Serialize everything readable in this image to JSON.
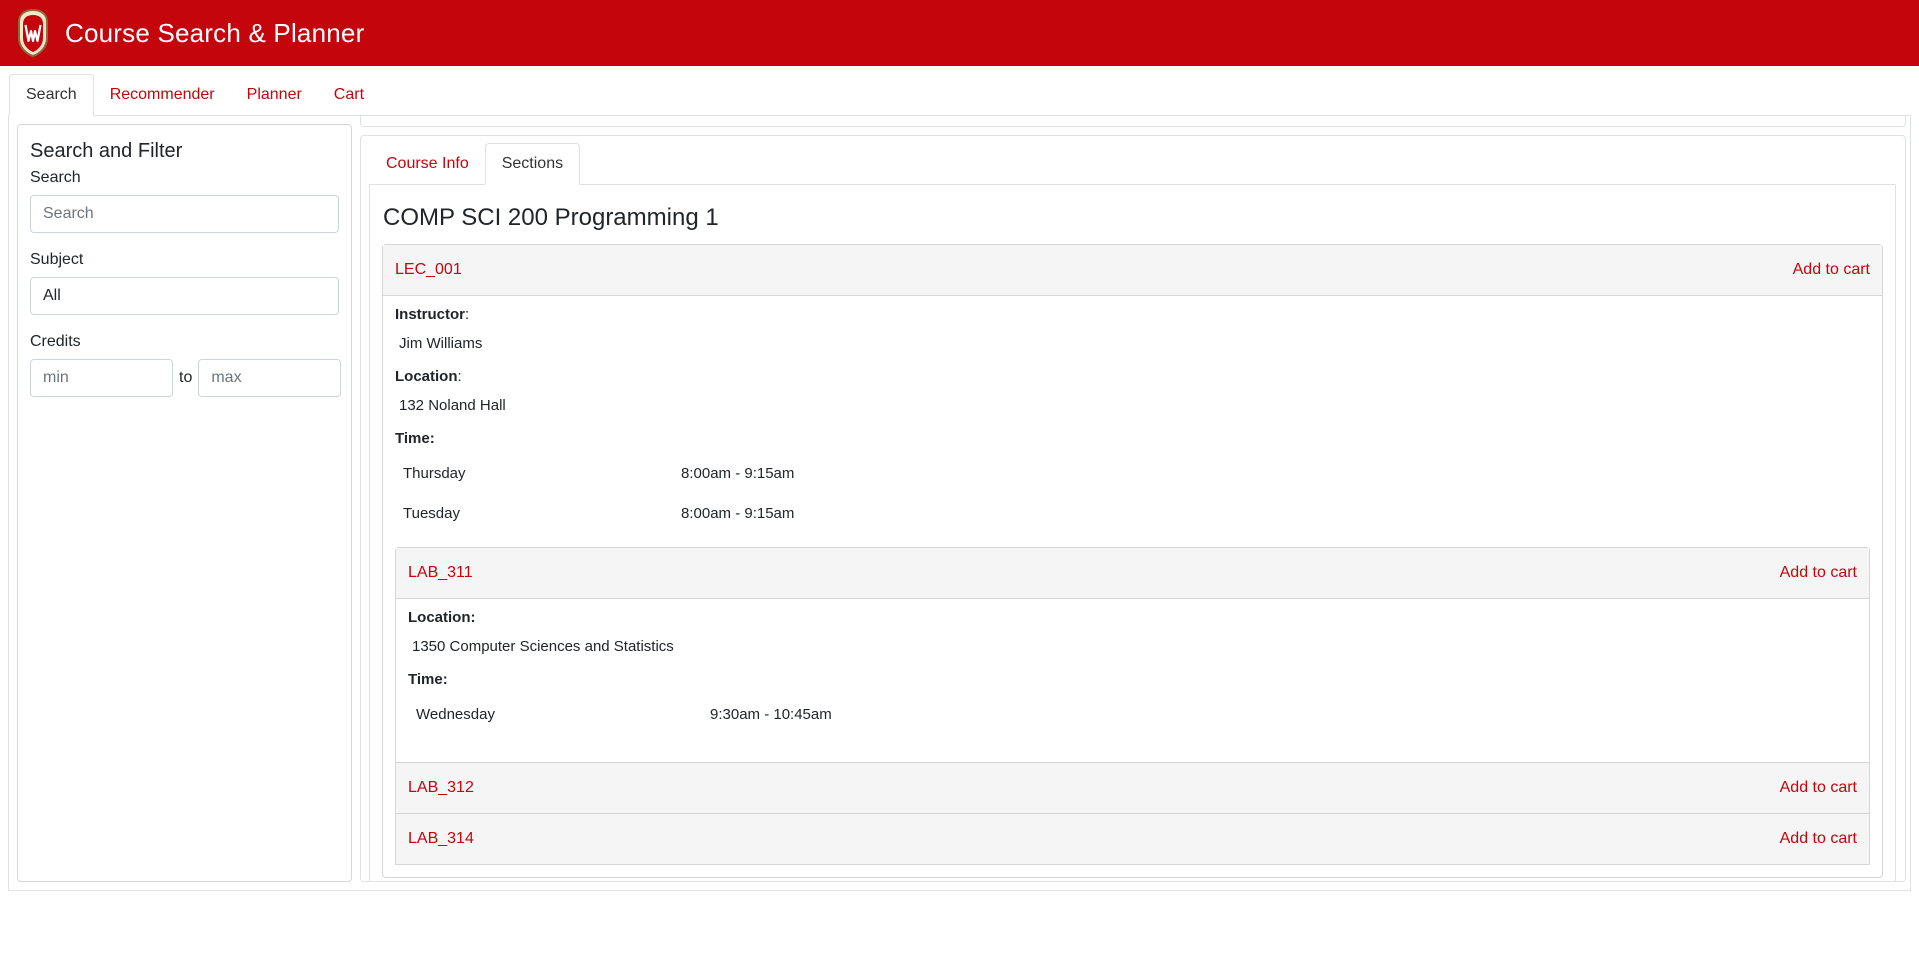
{
  "app": {
    "title": "Course Search & Planner",
    "brand_color": "#c5050c",
    "logo_icon": "uw-crest-icon"
  },
  "main_tabs": [
    {
      "label": "Search",
      "active": true
    },
    {
      "label": "Recommender",
      "active": false
    },
    {
      "label": "Planner",
      "active": false
    },
    {
      "label": "Cart",
      "active": false
    }
  ],
  "sidebar": {
    "title": "Search and Filter",
    "search_label": "Search",
    "search_placeholder": "Search",
    "subject_label": "Subject",
    "subject_value": "All",
    "credits_label": "Credits",
    "credits_min_placeholder": "min",
    "credits_to": "to",
    "credits_max_placeholder": "max"
  },
  "detail_tabs": [
    {
      "label": "Course Info",
      "active": false
    },
    {
      "label": "Sections",
      "active": true
    }
  ],
  "course": {
    "title": "COMP SCI 200 Programming 1",
    "lecture": {
      "name": "LEC_001",
      "add_to_cart": "Add to cart",
      "instructor_label": "Instructor",
      "instructor_colon": ":",
      "instructor": "Jim Williams",
      "location_label": "Location",
      "location_colon": ":",
      "location": "132 Noland Hall",
      "time_label": "Time:",
      "times": [
        {
          "day": "Thursday",
          "time": "8:00am - 9:15am"
        },
        {
          "day": "Tuesday",
          "time": "8:00am - 9:15am"
        }
      ]
    },
    "labs": [
      {
        "name": "LAB_311",
        "add_to_cart": "Add to cart",
        "location_label": "Location:",
        "location": "1350 Computer Sciences and Statistics",
        "time_label": "Time:",
        "times": [
          {
            "day": "Wednesday",
            "time": "9:30am - 10:45am"
          }
        ]
      },
      {
        "name": "LAB_312",
        "add_to_cart": "Add to cart"
      },
      {
        "name": "LAB_314",
        "add_to_cart": "Add to cart"
      }
    ]
  }
}
